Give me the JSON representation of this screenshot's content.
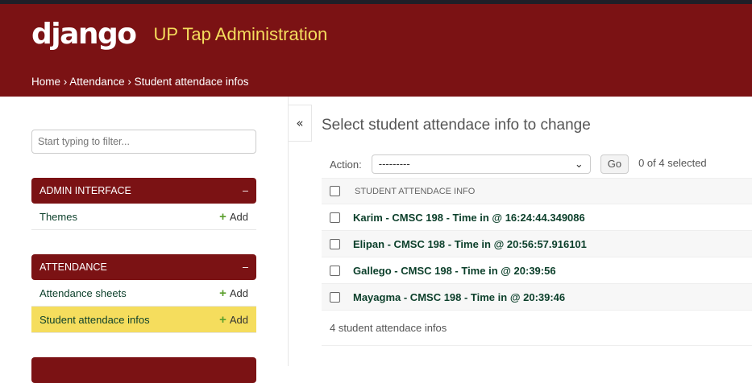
{
  "header": {
    "logo": "django",
    "site_title": "UP Tap Administration"
  },
  "breadcrumbs": [
    "Home",
    "Attendance",
    "Student attendace infos"
  ],
  "breadcrumb_sep": " › ",
  "sidebar": {
    "filter_placeholder": "Start typing to filter...",
    "toggle": "«",
    "modules": [
      {
        "title": "ADMIN INTERFACE",
        "collapse": "–",
        "items": [
          {
            "label": "Themes",
            "add": "Add"
          }
        ]
      },
      {
        "title": "ATTENDANCE",
        "collapse": "–",
        "items": [
          {
            "label": "Attendance sheets",
            "add": "Add"
          },
          {
            "label": "Student attendace infos",
            "add": "Add",
            "selected": true
          }
        ]
      }
    ]
  },
  "main": {
    "title": "Select student attendace info to change",
    "action_label": "Action:",
    "action_value": "---------",
    "go": "Go",
    "selected_count": "0 of 4 selected",
    "column": "STUDENT ATTENDACE INFO",
    "rows": [
      "Karim - CMSC 198 - Time in @ 16:24:44.349086",
      "Elipan - CMSC 198 - Time in @ 20:56:57.916101",
      "Gallego - CMSC 198 - Time in @ 20:39:56",
      "Mayagma - CMSC 198 - Time in @ 20:39:46"
    ],
    "paginator": "4 student attendace infos"
  }
}
